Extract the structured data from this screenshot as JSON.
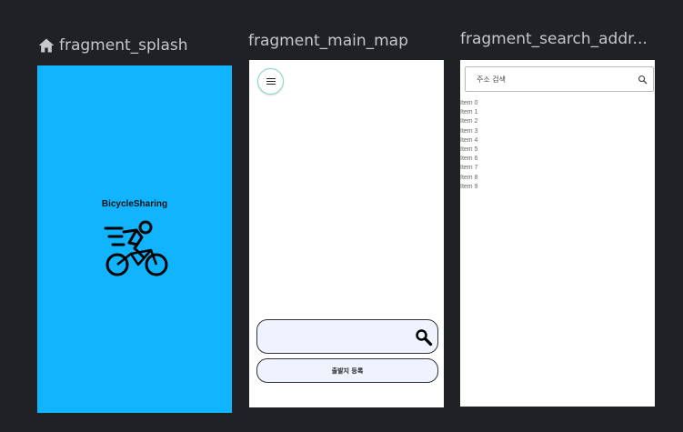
{
  "fragments": {
    "splash": {
      "title": "fragment_splash",
      "app_name": "BicycleSharing",
      "background_color": "#10b4ff",
      "icon": "cyclist-icon"
    },
    "main_map": {
      "title": "fragment_main_map",
      "menu_icon": "hamburger-menu-icon",
      "search_icon": "magnifier-icon",
      "depart_button_label": "출발지 등록"
    },
    "search_address": {
      "title": "fragment_search_addr...",
      "search_placeholder": "주소 검색",
      "search_icon": "magnifier-icon",
      "items": [
        "Item 0",
        "Item 1",
        "Item 2",
        "Item 3",
        "Item 4",
        "Item 5",
        "Item 6",
        "Item 7",
        "Item 8",
        "Item 9"
      ]
    }
  },
  "colors": {
    "canvas": "#1f2124",
    "title_text": "#c5c8cc",
    "button_fill": "#eef3ff"
  }
}
